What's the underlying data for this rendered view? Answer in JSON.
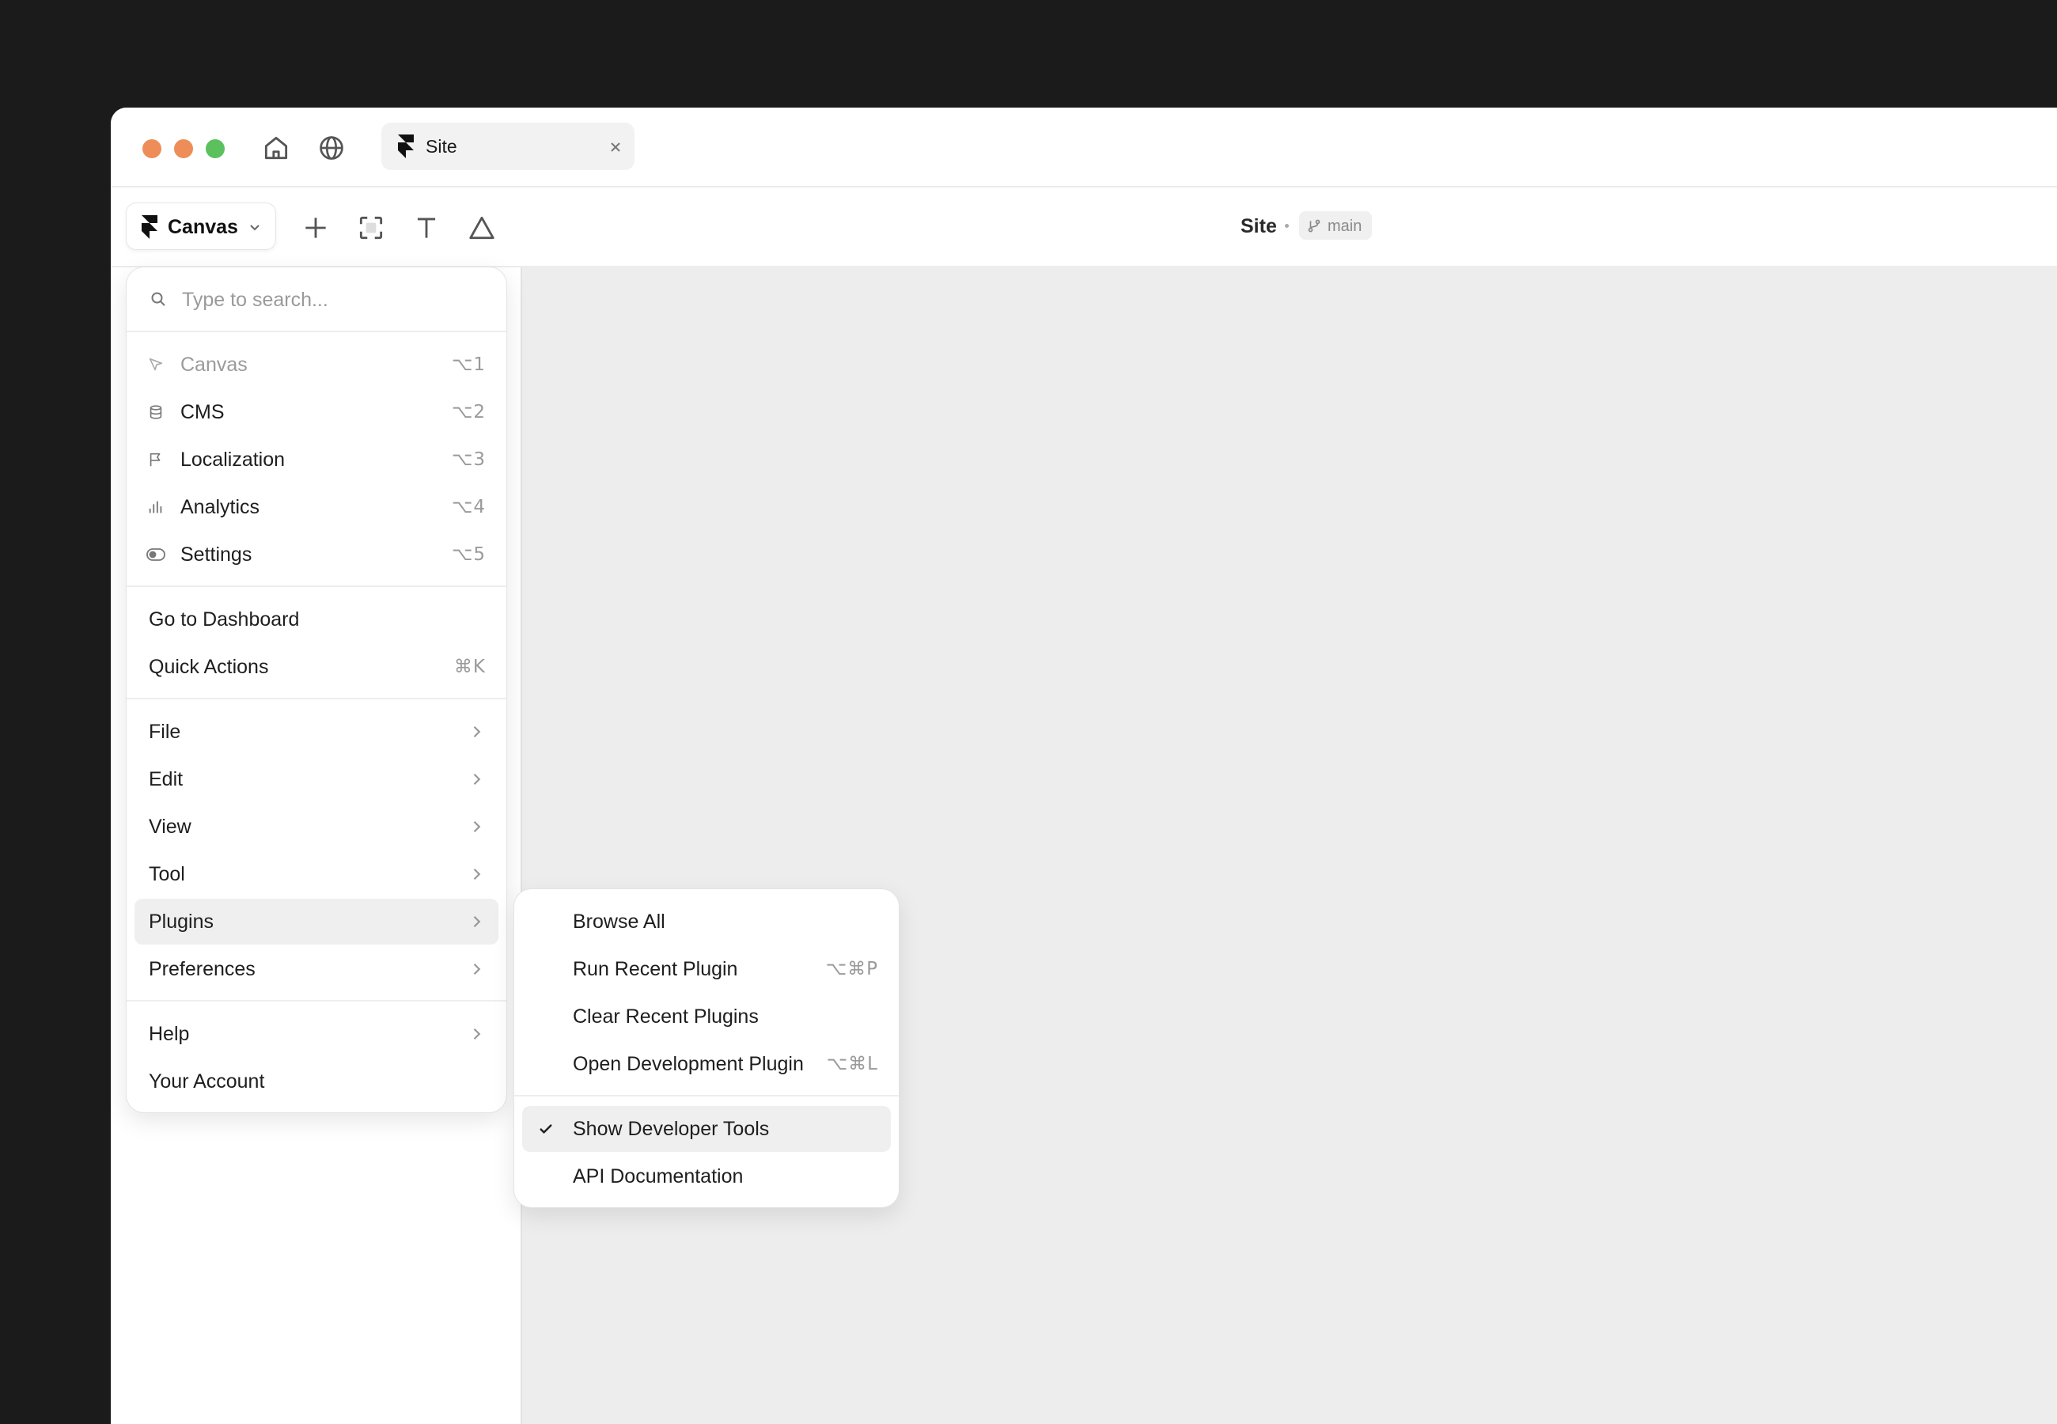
{
  "window": {
    "traffic_lights": [
      {
        "name": "close",
        "color": "#ee8d58"
      },
      {
        "name": "minimize",
        "color": "#ee8d58"
      },
      {
        "name": "zoom",
        "color": "#5cc15c"
      }
    ],
    "nav_icons": [
      "home-icon",
      "globe-icon"
    ],
    "tab": {
      "title": "Site",
      "icon": "framer-logo-icon",
      "close_icon": "close-icon"
    }
  },
  "toolbar": {
    "mode_label": "Canvas",
    "tool_icons": [
      "plus-icon",
      "frame-icon",
      "text-tool-icon",
      "triangle-icon"
    ],
    "project_title": "Site",
    "branch": "main"
  },
  "main_menu": {
    "search_placeholder": "Type to search...",
    "modes": [
      {
        "label": "Canvas",
        "shortcut": "⌥1",
        "icon": "cursor-icon",
        "disabled": true
      },
      {
        "label": "CMS",
        "shortcut": "⌥2",
        "icon": "database-icon"
      },
      {
        "label": "Localization",
        "shortcut": "⌥3",
        "icon": "flag-icon"
      },
      {
        "label": "Analytics",
        "shortcut": "⌥4",
        "icon": "bar-chart-icon"
      },
      {
        "label": "Settings",
        "shortcut": "⌥5",
        "icon": "toggle-icon"
      }
    ],
    "actions": [
      {
        "label": "Go to Dashboard"
      },
      {
        "label": "Quick Actions",
        "shortcut": "⌘K"
      }
    ],
    "menus": [
      {
        "label": "File"
      },
      {
        "label": "Edit"
      },
      {
        "label": "View"
      },
      {
        "label": "Tool"
      },
      {
        "label": "Plugins",
        "highlighted": true
      },
      {
        "label": "Preferences"
      }
    ],
    "footer": [
      {
        "label": "Help",
        "has_submenu": true
      },
      {
        "label": "Your Account"
      }
    ]
  },
  "plugins_submenu": {
    "items": [
      {
        "label": "Browse All"
      },
      {
        "label": "Run Recent Plugin",
        "shortcut": "⌥⌘P"
      },
      {
        "label": "Clear Recent Plugins"
      },
      {
        "label": "Open Development Plugin",
        "shortcut": "⌥⌘L"
      }
    ],
    "toggles": [
      {
        "label": "Show Developer Tools",
        "checked": true,
        "highlighted": true
      },
      {
        "label": "API Documentation"
      }
    ]
  }
}
